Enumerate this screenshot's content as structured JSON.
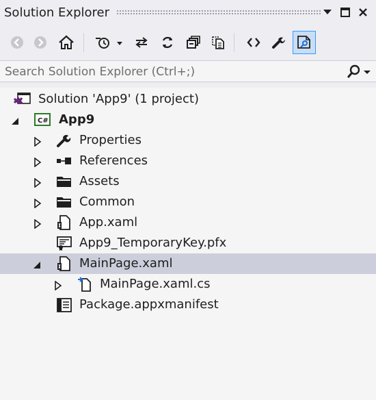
{
  "titlebar": {
    "title": "Solution Explorer",
    "dropdown_icon": "dropdown-arrow-icon",
    "maximize_icon": "maximize-icon",
    "close_icon": "close-icon"
  },
  "toolbar": {
    "buttons": [
      {
        "name": "back-icon"
      },
      {
        "name": "forward-icon"
      },
      {
        "name": "home-icon"
      },
      {
        "name": "pending-changes-filter-icon"
      },
      {
        "name": "sync-with-active-document-icon"
      },
      {
        "name": "refresh-icon"
      },
      {
        "name": "collapse-all-icon"
      },
      {
        "name": "show-all-files-icon"
      },
      {
        "name": "view-code-icon"
      },
      {
        "name": "properties-icon"
      },
      {
        "name": "preview-selected-items-icon"
      }
    ]
  },
  "search": {
    "placeholder": "Search Solution Explorer (Ctrl+;)",
    "value": ""
  },
  "tree": {
    "solution": {
      "label": "Solution 'App9' (1 project)",
      "icon": "solution-icon"
    },
    "project": {
      "label": "App9",
      "icon": "csharp-project-icon",
      "expanded": true
    },
    "items": [
      {
        "label": "Properties",
        "icon": "wrench-icon",
        "expandable": true
      },
      {
        "label": "References",
        "icon": "references-icon",
        "expandable": true
      },
      {
        "label": "Assets",
        "icon": "folder-icon",
        "expandable": true
      },
      {
        "label": "Common",
        "icon": "folder-icon",
        "expandable": true
      },
      {
        "label": "App.xaml",
        "icon": "xaml-file-icon",
        "expandable": true
      },
      {
        "label": "App9_TemporaryKey.pfx",
        "icon": "certificate-icon",
        "expandable": false
      },
      {
        "label": "MainPage.xaml",
        "icon": "xaml-file-icon",
        "expandable": true,
        "expanded": true,
        "selected": true
      },
      {
        "label": "MainPage.xaml.cs",
        "icon": "csharp-file-icon",
        "expandable": true,
        "child": true
      },
      {
        "label": "Package.appxmanifest",
        "icon": "manifest-icon",
        "expandable": false
      }
    ]
  }
}
